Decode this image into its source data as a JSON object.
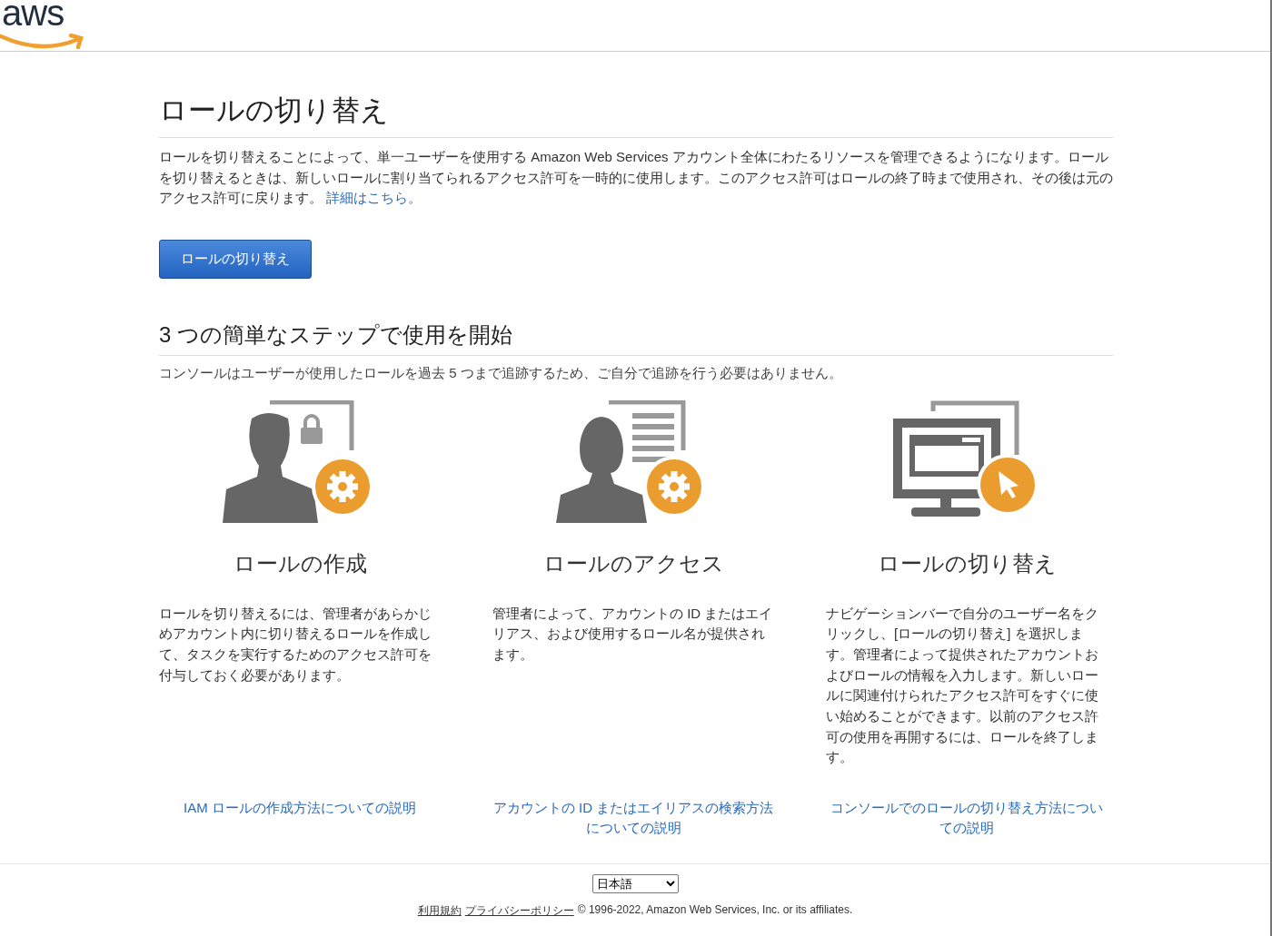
{
  "header": {
    "logo": "aws"
  },
  "title": "ロールの切り替え",
  "intro": {
    "text": "ロールを切り替えることによって、単一ユーザーを使用する Amazon Web Services アカウント全体にわたるリソースを管理できるようになります。ロールを切り替えるときは、新しいロールに割り当てられるアクセス許可を一時的に使用します。このアクセス許可はロールの終了時まで使用され、その後は元のアクセス許可に戻ります。",
    "link": "詳細はこちら。"
  },
  "button": "ロールの切り替え",
  "steps_heading": "3 つの簡単なステップで使用を開始",
  "steps_note": "コンソールはユーザーが使用したロールを過去 5 つまで追跡するため、ご自分で追跡を行う必要はありません。",
  "steps": [
    {
      "kind": "create",
      "title": "ロールの作成",
      "body": "ロールを切り替えるには、管理者があらかじめアカウント内に切り替えるロールを作成して、タスクを実行するためのアクセス許可を付与しておく必要があります。",
      "link": "IAM ロールの作成方法についての説明"
    },
    {
      "kind": "access",
      "title": "ロールのアクセス",
      "body": "管理者によって、アカウントの ID またはエイリアス、および使用するロール名が提供されます。",
      "link": "アカウントの ID またはエイリアスの検索方法についての説明"
    },
    {
      "kind": "switch",
      "title": "ロールの切り替え",
      "body": "ナビゲーションバーで自分のユーザー名をクリックし、[ロールの切り替え] を選択します。管理者によって提供されたアカウントおよびロールの情報を入力します。新しいロールに関連付けられたアクセス許可をすぐに使い始めることができます。以前のアクセス許可の使用を再開するには、ロールを終了します。",
      "link": "コンソールでのロールの切り替え方法についての説明"
    }
  ],
  "footer": {
    "language": "日本語",
    "links": [
      "利用規約",
      "プライバシーポリシー"
    ],
    "copyright": "© 1996-2022, Amazon Web Services, Inc. or its affiliates."
  }
}
